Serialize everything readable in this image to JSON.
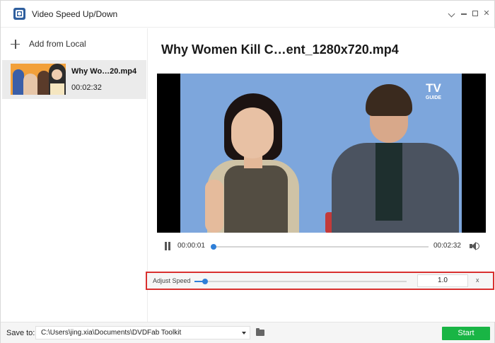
{
  "window": {
    "title": "Video Speed Up/Down",
    "controls": [
      "pin-icon",
      "minimize-icon",
      "maximize-icon",
      "close-icon"
    ]
  },
  "sidebar": {
    "add_label": "Add from Local",
    "files": [
      {
        "name": "Why Wo…20.mp4",
        "duration": "00:02:32"
      }
    ]
  },
  "main": {
    "video_title": "Why Women Kill C…ent_1280x720.mp4",
    "preview_logo": {
      "line1": "TV",
      "line2": "GUIDE"
    }
  },
  "player": {
    "current_time": "00:00:01",
    "total_time": "00:02:32",
    "progress_fraction": 0.01
  },
  "speed": {
    "label": "Adjust Speed",
    "value": "1.0",
    "unit": "x",
    "slider_fraction": 0.05
  },
  "footer": {
    "save_label": "Save to:",
    "path": "C:\\Users\\jing.xia\\Documents\\DVDFab Toolkit",
    "start_label": "Start"
  },
  "colors": {
    "accent_blue": "#2f7fd8",
    "start_green": "#19b545",
    "highlight_red": "#d9302f",
    "app_icon_blue": "#2f5f9e"
  }
}
